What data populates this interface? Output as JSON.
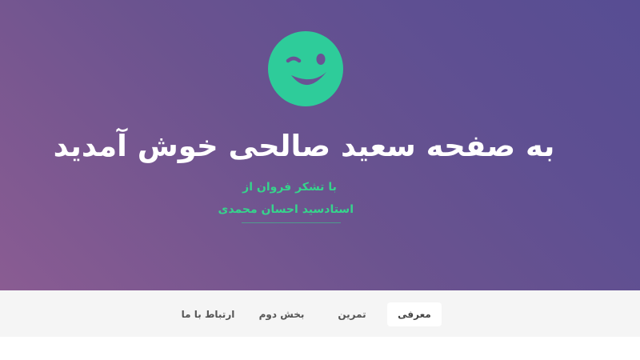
{
  "hero": {
    "title": "به صفحه سعید صالحی خوش آمدید",
    "credit_line1": "با تشکر فروان از",
    "credit_line2": "استادسید احسان محمدی",
    "icon": "winking-smiley-icon",
    "icon_color": "#2ecc9a",
    "accent_color": "#36d48c",
    "gradient_colors": [
      "#8a5c92",
      "#574d93"
    ]
  },
  "nav": {
    "items": [
      {
        "label": "معرفی",
        "active": true
      },
      {
        "label": "تمرین",
        "active": false
      },
      {
        "label": "بخش دوم",
        "active": false
      },
      {
        "label": "ارتباط با ما",
        "active": false
      }
    ]
  }
}
